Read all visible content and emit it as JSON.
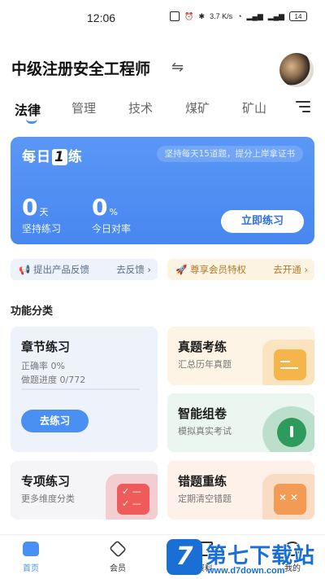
{
  "status_bar": {
    "time": "12:06",
    "net_speed": "3.7 K/s",
    "battery": "14"
  },
  "header": {
    "exam_title": "中级注册安全工程师",
    "switch_icon": "⇋"
  },
  "tabs": [
    "法律",
    "管理",
    "技术",
    "煤矿",
    "矿山"
  ],
  "daily": {
    "title_prefix": "每日",
    "title_number": "1",
    "title_suffix": "练",
    "tip": "坚持每天15道题，提分上岸拿证书",
    "stat_days_value": "0",
    "stat_days_unit": "天",
    "stat_days_label": "坚持练习",
    "stat_rate_value": "0",
    "stat_rate_unit": "%",
    "stat_rate_label": "今日对率",
    "start_button": "立即练习"
  },
  "feedback_bar": {
    "label": "提出产品反馈",
    "action": "去反馈"
  },
  "vip_bar": {
    "label": "尊享会员特权",
    "action": "去开通"
  },
  "section_title": "功能分类",
  "cards": {
    "chapter": {
      "title": "章节练习",
      "accuracy": "正确率 0%",
      "progress_text": "做题进度 0/772",
      "progress_fraction": 0,
      "button": "去练习"
    },
    "real": {
      "title": "真题考练",
      "subtitle": "汇总历年真题"
    },
    "smart": {
      "title": "智能组卷",
      "subtitle": "模拟真实考试"
    },
    "special": {
      "title": "专项练习",
      "subtitle": "更多维度分类"
    },
    "wrong": {
      "title": "错题重练",
      "subtitle": "定期清空错题"
    }
  },
  "bottom_nav": [
    {
      "label": "首页",
      "icon": "home-icon",
      "active": true
    },
    {
      "label": "会员",
      "icon": "vip-icon",
      "active": false
    },
    {
      "label": "资料",
      "icon": "book-icon",
      "active": false
    },
    {
      "label": "我的",
      "icon": "profile-icon",
      "active": false
    }
  ],
  "watermark": {
    "logo_char": "7",
    "name": "第七下载站",
    "url": "www.d7down.com"
  },
  "colors": {
    "accent": "#4a8ff2",
    "card_blue": "#4787f0",
    "vip_gold": "#b07b2a"
  }
}
